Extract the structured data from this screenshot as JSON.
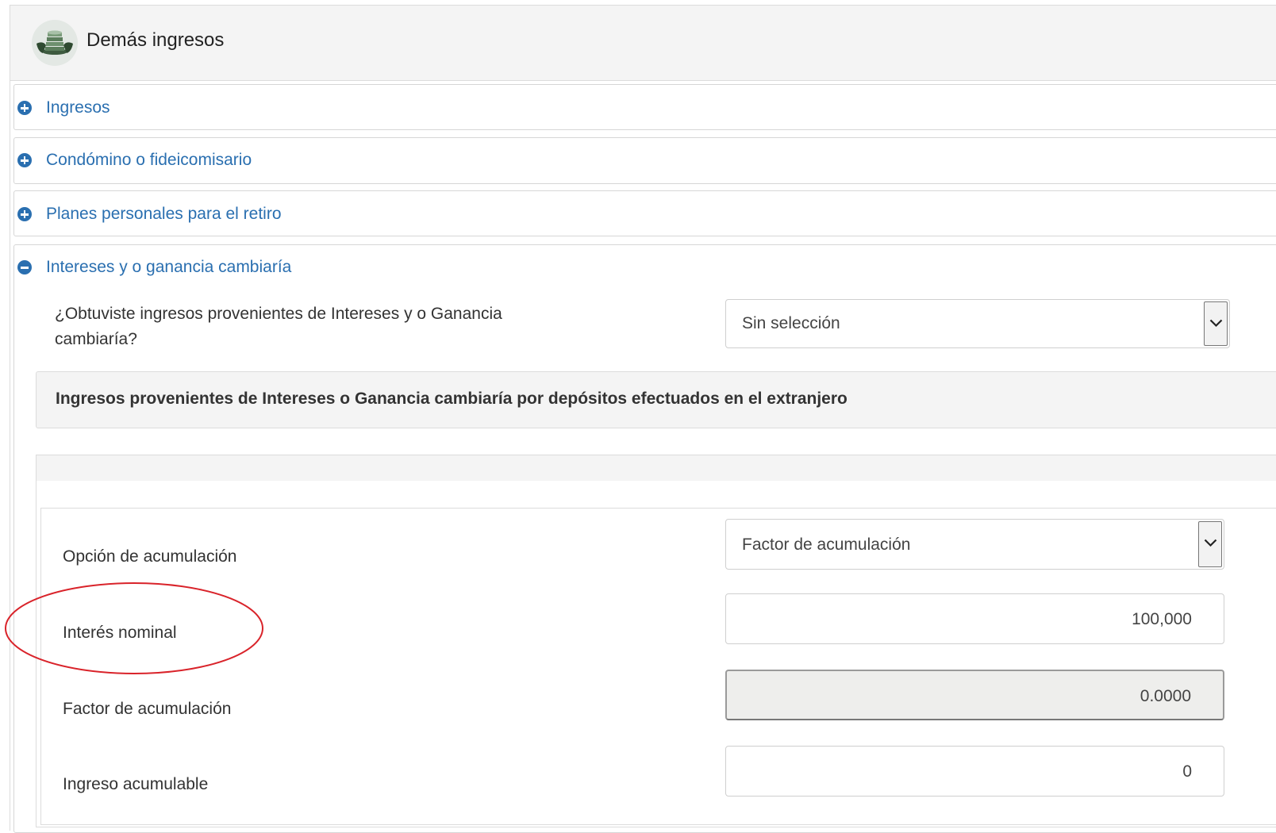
{
  "header": {
    "title": "Demás ingresos",
    "logo_icon": "coins-stack-icon"
  },
  "sections": [
    {
      "label": "Ingresos",
      "state": "collapsed",
      "icon": "plus-circle-icon"
    },
    {
      "label": "Condómino o fideicomisario",
      "state": "collapsed",
      "icon": "plus-circle-icon"
    },
    {
      "label": "Planes personales para el retiro",
      "state": "collapsed",
      "icon": "plus-circle-icon"
    },
    {
      "label": "Intereses y o ganancia cambiaría",
      "state": "expanded",
      "icon": "minus-circle-icon"
    }
  ],
  "question": {
    "text": "¿Obtuviste ingresos provenientes de Intereses y o Ganancia cambiaría?",
    "selected": "Sin selección"
  },
  "subheading": "Ingresos provenientes de Intereses o Ganancia cambiaría por depósitos efectuados en el extranjero",
  "fields": {
    "accumulation_option": {
      "label": "Opción de acumulación",
      "selected": "Factor de acumulación"
    },
    "nominal_interest": {
      "label": "Interés nominal",
      "value": "100,000"
    },
    "accumulation_factor": {
      "label": "Factor de acumulación",
      "value": "0.0000"
    },
    "accumulable_income": {
      "label": "Ingreso acumulable",
      "value": "0"
    }
  },
  "colors": {
    "link_blue": "#2a6fb0",
    "annotation_red": "#d9232a",
    "header_bg": "#f4f4f4"
  }
}
